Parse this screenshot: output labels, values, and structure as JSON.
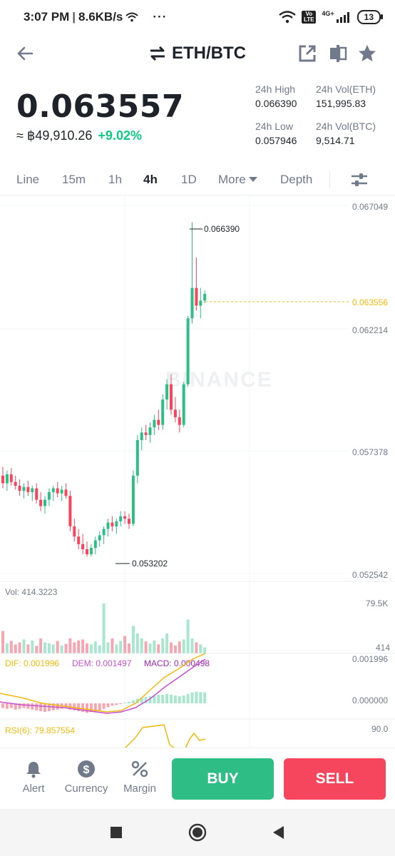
{
  "status": {
    "time": "3:07 PM",
    "speed": "8.6KB/s",
    "more": "···",
    "volte": "Vo LTE",
    "network": "4G+",
    "battery": "13"
  },
  "header": {
    "title": "ETH/BTC"
  },
  "price": {
    "last": "0.063557",
    "fiat": "≈ ฿49,910.26",
    "change": "+9.02%"
  },
  "stats": {
    "high_label": "24h High",
    "high_value": "0.066390",
    "vol_base_label": "24h Vol(ETH)",
    "vol_base_value": "151,995.83",
    "low_label": "24h Low",
    "low_value": "0.057946",
    "vol_quote_label": "24h Vol(BTC)",
    "vol_quote_value": "9,514.71"
  },
  "tabs": [
    {
      "label": "Line"
    },
    {
      "label": "15m"
    },
    {
      "label": "1h"
    },
    {
      "label": "4h",
      "active": true
    },
    {
      "label": "1D"
    },
    {
      "label": "More"
    },
    {
      "label": "Depth"
    }
  ],
  "chart": {
    "watermark": "BINANCE",
    "price_axis": [
      "0.067049",
      "0.062214",
      "0.057378",
      "0.052542"
    ],
    "current_price_tag": "0.063556",
    "high_marker": "0.066390",
    "low_marker": "0.053202",
    "vol_label": "Vol: 414.3223",
    "vol_axis_top": "79.5K",
    "vol_axis_bottom": "414",
    "macd_dif": "DIF: 0.001996",
    "macd_dem": "DEM: 0.001497",
    "macd_val": "MACD: 0.000498",
    "macd_axis_top": "0.001996",
    "macd_axis_zero": "0.000000",
    "rsi_label": "RSI(6): 79.857554",
    "rsi_axis_top": "90.0",
    "colors": {
      "up": "#2ebd85",
      "down": "#f6465d",
      "dif": "#f0b90b",
      "dem": "#c74fd0",
      "rsi": "#f0b90b"
    }
  },
  "chart_data": {
    "type": "candlestick",
    "interval": "4h",
    "price_range": [
      0.052542,
      0.067049
    ],
    "candles": [
      {
        "o": 0.0564,
        "h": 0.05675,
        "l": 0.0559,
        "c": 0.0561
      },
      {
        "o": 0.0561,
        "h": 0.0566,
        "l": 0.0558,
        "c": 0.05645
      },
      {
        "o": 0.05645,
        "h": 0.0567,
        "l": 0.056,
        "c": 0.05615
      },
      {
        "o": 0.05615,
        "h": 0.0564,
        "l": 0.05585,
        "c": 0.056
      },
      {
        "o": 0.056,
        "h": 0.05625,
        "l": 0.0556,
        "c": 0.0558
      },
      {
        "o": 0.0558,
        "h": 0.0561,
        "l": 0.0555,
        "c": 0.05595
      },
      {
        "o": 0.05595,
        "h": 0.0562,
        "l": 0.0556,
        "c": 0.05575
      },
      {
        "o": 0.05575,
        "h": 0.056,
        "l": 0.0554,
        "c": 0.0559
      },
      {
        "o": 0.0559,
        "h": 0.0561,
        "l": 0.0553,
        "c": 0.05545
      },
      {
        "o": 0.05545,
        "h": 0.05575,
        "l": 0.055,
        "c": 0.0552
      },
      {
        "o": 0.0552,
        "h": 0.0556,
        "l": 0.0549,
        "c": 0.05545
      },
      {
        "o": 0.05545,
        "h": 0.0559,
        "l": 0.0552,
        "c": 0.05575
      },
      {
        "o": 0.05575,
        "h": 0.056,
        "l": 0.0554,
        "c": 0.0559
      },
      {
        "o": 0.0559,
        "h": 0.05615,
        "l": 0.05555,
        "c": 0.0557
      },
      {
        "o": 0.0557,
        "h": 0.056,
        "l": 0.0554,
        "c": 0.05585
      },
      {
        "o": 0.05585,
        "h": 0.0561,
        "l": 0.0555,
        "c": 0.0556
      },
      {
        "o": 0.0556,
        "h": 0.0558,
        "l": 0.0542,
        "c": 0.0544
      },
      {
        "o": 0.0544,
        "h": 0.0547,
        "l": 0.0538,
        "c": 0.054
      },
      {
        "o": 0.054,
        "h": 0.0543,
        "l": 0.0535,
        "c": 0.0537
      },
      {
        "o": 0.0537,
        "h": 0.0541,
        "l": 0.0533,
        "c": 0.0535
      },
      {
        "o": 0.0535,
        "h": 0.0538,
        "l": 0.0532,
        "c": 0.0533
      },
      {
        "o": 0.0533,
        "h": 0.0537,
        "l": 0.0532,
        "c": 0.05355
      },
      {
        "o": 0.05355,
        "h": 0.054,
        "l": 0.0533,
        "c": 0.05385
      },
      {
        "o": 0.05385,
        "h": 0.0542,
        "l": 0.0536,
        "c": 0.05405
      },
      {
        "o": 0.05405,
        "h": 0.0544,
        "l": 0.0537,
        "c": 0.0543
      },
      {
        "o": 0.0543,
        "h": 0.0547,
        "l": 0.054,
        "c": 0.05455
      },
      {
        "o": 0.05455,
        "h": 0.0548,
        "l": 0.0542,
        "c": 0.0544
      },
      {
        "o": 0.0544,
        "h": 0.0547,
        "l": 0.0541,
        "c": 0.0546
      },
      {
        "o": 0.0546,
        "h": 0.055,
        "l": 0.0544,
        "c": 0.0548
      },
      {
        "o": 0.0548,
        "h": 0.055,
        "l": 0.0545,
        "c": 0.0547
      },
      {
        "o": 0.0547,
        "h": 0.0549,
        "l": 0.0543,
        "c": 0.0545
      },
      {
        "o": 0.0545,
        "h": 0.0566,
        "l": 0.0544,
        "c": 0.0564
      },
      {
        "o": 0.0564,
        "h": 0.058,
        "l": 0.0561,
        "c": 0.0578
      },
      {
        "o": 0.0578,
        "h": 0.0583,
        "l": 0.0574,
        "c": 0.0581
      },
      {
        "o": 0.0581,
        "h": 0.0584,
        "l": 0.0578,
        "c": 0.058
      },
      {
        "o": 0.058,
        "h": 0.0585,
        "l": 0.0577,
        "c": 0.0583
      },
      {
        "o": 0.0583,
        "h": 0.0588,
        "l": 0.058,
        "c": 0.0586
      },
      {
        "o": 0.0586,
        "h": 0.059,
        "l": 0.0582,
        "c": 0.0584
      },
      {
        "o": 0.0584,
        "h": 0.0596,
        "l": 0.0582,
        "c": 0.0594
      },
      {
        "o": 0.0594,
        "h": 0.0602,
        "l": 0.059,
        "c": 0.06
      },
      {
        "o": 0.06,
        "h": 0.0604,
        "l": 0.0588,
        "c": 0.059
      },
      {
        "o": 0.059,
        "h": 0.0595,
        "l": 0.0585,
        "c": 0.0587
      },
      {
        "o": 0.0587,
        "h": 0.059,
        "l": 0.0581,
        "c": 0.0584
      },
      {
        "o": 0.0584,
        "h": 0.0601,
        "l": 0.0583,
        "c": 0.06
      },
      {
        "o": 0.06,
        "h": 0.0627,
        "l": 0.0599,
        "c": 0.0626
      },
      {
        "o": 0.0626,
        "h": 0.06639,
        "l": 0.0624,
        "c": 0.0638
      },
      {
        "o": 0.0638,
        "h": 0.065,
        "l": 0.0629,
        "c": 0.0631
      },
      {
        "o": 0.0631,
        "h": 0.0638,
        "l": 0.0626,
        "c": 0.0633
      },
      {
        "o": 0.0633,
        "h": 0.0637,
        "l": 0.0632,
        "c": 0.06356
      }
    ],
    "volume_scale": [
      414,
      79500
    ],
    "volume": [
      0.45,
      0.2,
      0.25,
      0.18,
      0.22,
      0.28,
      0.18,
      0.26,
      0.15,
      0.3,
      0.22,
      0.2,
      0.18,
      0.25,
      0.16,
      0.19,
      0.3,
      0.22,
      0.26,
      0.28,
      0.2,
      0.18,
      0.24,
      0.16,
      1.0,
      0.22,
      0.3,
      0.18,
      0.25,
      0.35,
      0.2,
      0.55,
      0.4,
      0.3,
      0.24,
      0.2,
      0.26,
      0.18,
      0.3,
      0.4,
      0.22,
      0.16,
      0.24,
      0.28,
      0.68,
      0.3,
      0.22,
      0.18,
      0.12
    ],
    "macd_hist": [
      -0.3,
      -0.35,
      -0.3,
      -0.4,
      -0.35,
      -0.3,
      -0.35,
      -0.4,
      -0.45,
      -0.5,
      -0.55,
      -0.5,
      -0.45,
      -0.4,
      -0.35,
      -0.3,
      -0.4,
      -0.45,
      -0.5,
      -0.55,
      -0.6,
      -0.55,
      -0.5,
      -0.45,
      -0.35,
      -0.25,
      -0.15,
      -0.1,
      -0.05,
      0.05,
      0.1,
      0.2,
      0.3,
      0.35,
      0.4,
      0.45,
      0.5,
      0.55,
      0.55,
      0.6,
      0.55,
      0.5,
      0.45,
      0.5,
      0.6,
      0.7,
      0.75,
      0.72,
      0.7
    ],
    "rsi_last": 79.857554
  },
  "actions": {
    "alert": "Alert",
    "currency": "Currency",
    "margin": "Margin",
    "buy": "BUY",
    "sell": "SELL"
  }
}
